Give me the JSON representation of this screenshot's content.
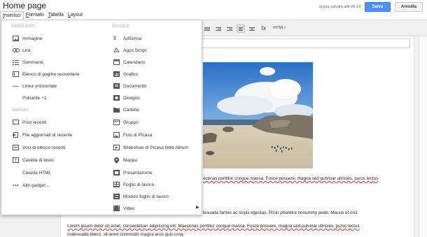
{
  "header": {
    "title": "Home page",
    "draft_status": "bozza salvata alle 06:19",
    "save_label": "Salva",
    "cancel_label": "Annulla"
  },
  "menubar": {
    "items": [
      {
        "pre": "",
        "u": "I",
        "post": "nserisci"
      },
      {
        "pre": "",
        "u": "F",
        "post": "ormato"
      },
      {
        "pre": "",
        "u": "T",
        "post": "abella"
      },
      {
        "pre": "",
        "u": "L",
        "post": "ayout"
      }
    ]
  },
  "toolbar": {
    "html_label": "<HTML>",
    "clear_format_glyph": "Ix"
  },
  "insert_menu": {
    "left_sections": {
      "frequenti": "FREQUENTI",
      "gadget": "GADGET"
    },
    "frequenti_items": [
      {
        "label": "Immagine",
        "icon": "image-icon"
      },
      {
        "label": "Link",
        "icon": "link-icon"
      },
      {
        "label": "Sommario",
        "icon": "table-of-contents-icon"
      },
      {
        "label": "Elenco di pagine secondarie",
        "icon": "subpages-icon"
      },
      {
        "label": "Linea orizzontale",
        "icon": "horizontal-line-icon"
      },
      {
        "label": "Pulsante +1",
        "icon": ""
      }
    ],
    "gadget_items": [
      {
        "label": "Post recenti",
        "icon": "recent-posts-icon"
      },
      {
        "label": "File aggiornati di recente",
        "icon": "recent-files-icon"
      },
      {
        "label": "Voci di elenco recenti",
        "icon": "recent-list-icon"
      },
      {
        "label": "Casella di testo",
        "icon": "text-box-icon"
      },
      {
        "label": "Casella HTML",
        "icon": ""
      },
      {
        "label": "Altri gadget...",
        "icon": "more-gadgets-icon"
      }
    ],
    "google_header": "GOOGLE",
    "google_items": [
      {
        "label": "AdSense",
        "icon": "adsense-icon"
      },
      {
        "label": "Apps Script",
        "icon": "apps-script-icon"
      },
      {
        "label": "Calendario",
        "icon": "calendar-icon"
      },
      {
        "label": "Grafico",
        "icon": "chart-icon"
      },
      {
        "label": "Documento",
        "icon": "document-icon"
      },
      {
        "label": "Disegno",
        "icon": "drawing-icon"
      },
      {
        "label": "Cartella",
        "icon": "folder-icon"
      },
      {
        "label": "Gruppo",
        "icon": "group-icon"
      },
      {
        "label": "Foto di Picasa",
        "icon": "picasa-photo-icon"
      },
      {
        "label": "Slideshow di Picasa Web Album",
        "icon": "slideshow-icon"
      },
      {
        "label": "Mappa",
        "icon": "map-icon"
      },
      {
        "label": "Presentazione",
        "icon": "presentation-icon"
      },
      {
        "label": "Foglio di lavoro",
        "icon": "spreadsheet-icon"
      },
      {
        "label": "Modulo foglio di lavoro",
        "icon": "form-icon"
      },
      {
        "label": "Video",
        "icon": "video-icon"
      }
    ]
  },
  "content": {
    "line1": "ecenas porttitor congue massa. Fusce posuere, magna sed pulvinar ultricies, purus lectus",
    "line2": "lesuada fames ac turpis egestas. Proin pharetra nonummy pede. Mauris et orci.",
    "line3": "Lorem ipsum dolor sit amet, consectetuer adipiscing elit. Maecenas porttitor congue massa. Fusce posuere, magna sed pulvinar ultricies, purus lectus",
    "line4": "malesuada libero, sit amet commodo magna eros quis urna."
  },
  "colors": {
    "save_button": "#4d90fe",
    "menu_border": "#c8c8c8"
  }
}
